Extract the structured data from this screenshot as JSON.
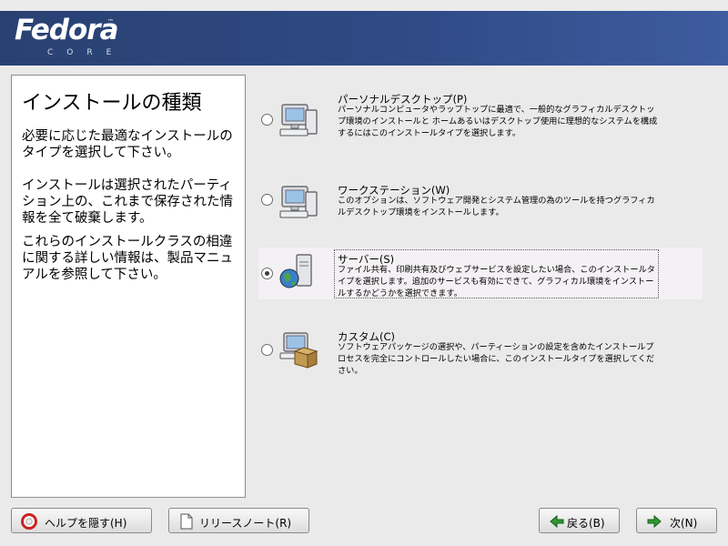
{
  "brand": {
    "name": "Fedora",
    "tm": "™",
    "subtitle": "CORE"
  },
  "help": {
    "title": "インストールの種類",
    "paragraphs": [
      "必要に応じた最適なインストールのタイプを選択して下さい。",
      "インストールは選択されたパーティション上の、これまで保存された情報を全て破棄します。",
      "これらのインストールクラスの相違に関する詳しい情報は、製品マニュアルを参照して下さい。"
    ]
  },
  "options": [
    {
      "title": "パーソナルデスクトップ(P)",
      "description": "パーソナルコンピュータやラップトップに最適で、一般的なグラフィカルデスクトップ環境のインストールと ホームあるいはデスクトップ使用に理想的なシステムを構成するにはこのインストールタイプを選択します。",
      "selected": false,
      "icon": "desktop-computer-icon"
    },
    {
      "title": "ワークステーション(W)",
      "description": "このオプションは、ソフトウェア開発とシステム管理の為のツールを持つグラフィカルデスクトップ環境をインストールします。",
      "selected": false,
      "icon": "workstation-computer-icon"
    },
    {
      "title": "サーバー(S)",
      "description": "ファイル共有、印刷共有及びウェブサービスを設定したい場合、このインストールタイプを選択します。追加のサービスも有効にできて、グラフィカル環境をインストールするかどうかを選択できます。",
      "selected": true,
      "icon": "server-globe-icon"
    },
    {
      "title": "カスタム(C)",
      "description": "ソフトウェアパッケージの選択や、パーティーションの設定を含めたインストールプロセスを完全にコントロールしたい場合に、このインストールタイプを選択してください。",
      "selected": false,
      "icon": "custom-package-icon"
    }
  ],
  "buttons": {
    "hide_help": "ヘルプを隠す(H)",
    "release_notes": "リリースノート(R)",
    "back": "戻る(B)",
    "next": "次(N)"
  },
  "colors": {
    "banner": "#294172",
    "panel_bg": "#ffffff",
    "window_bg": "#eaeaea"
  }
}
